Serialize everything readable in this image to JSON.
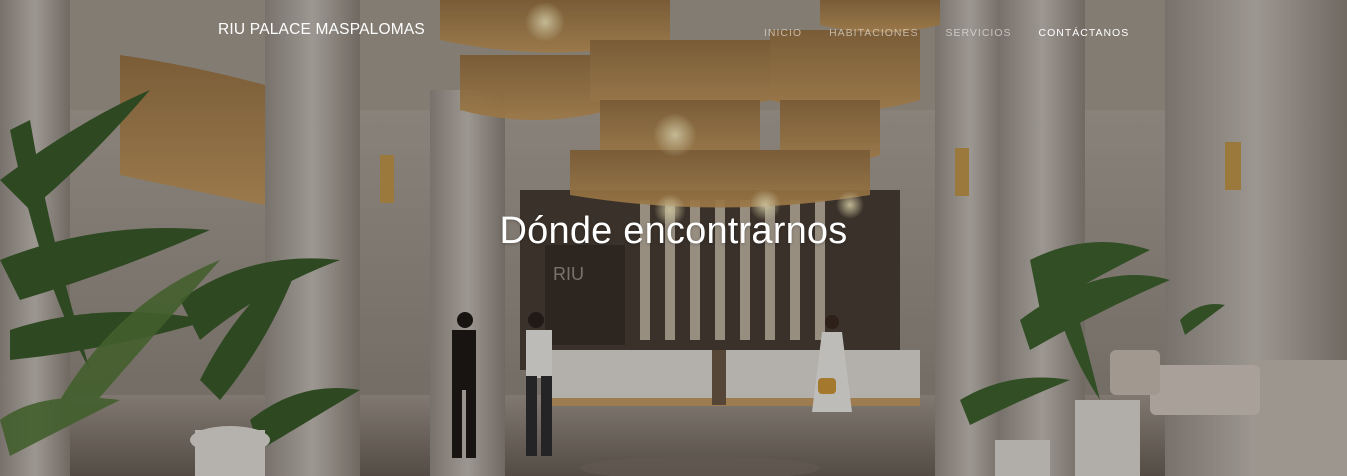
{
  "navbar": {
    "brand": "RIU PALACE MASPALOMAS",
    "links": [
      {
        "label": "INICIO",
        "active": false
      },
      {
        "label": "HABITACIONES",
        "active": false
      },
      {
        "label": "SERVICIOS",
        "active": false
      },
      {
        "label": "CONTÁCTANOS",
        "active": true
      }
    ]
  },
  "hero": {
    "title": "Dónde encontrarnos",
    "image_alt": "Hotel lobby with chandeliers, reception desk and palm plants",
    "reception_sign": "RIU"
  },
  "colors": {
    "nav_text_active": "#ffffff",
    "nav_text_muted": "rgba(255,255,255,0.55)",
    "overlay": "rgba(0,0,0,0.22)"
  }
}
